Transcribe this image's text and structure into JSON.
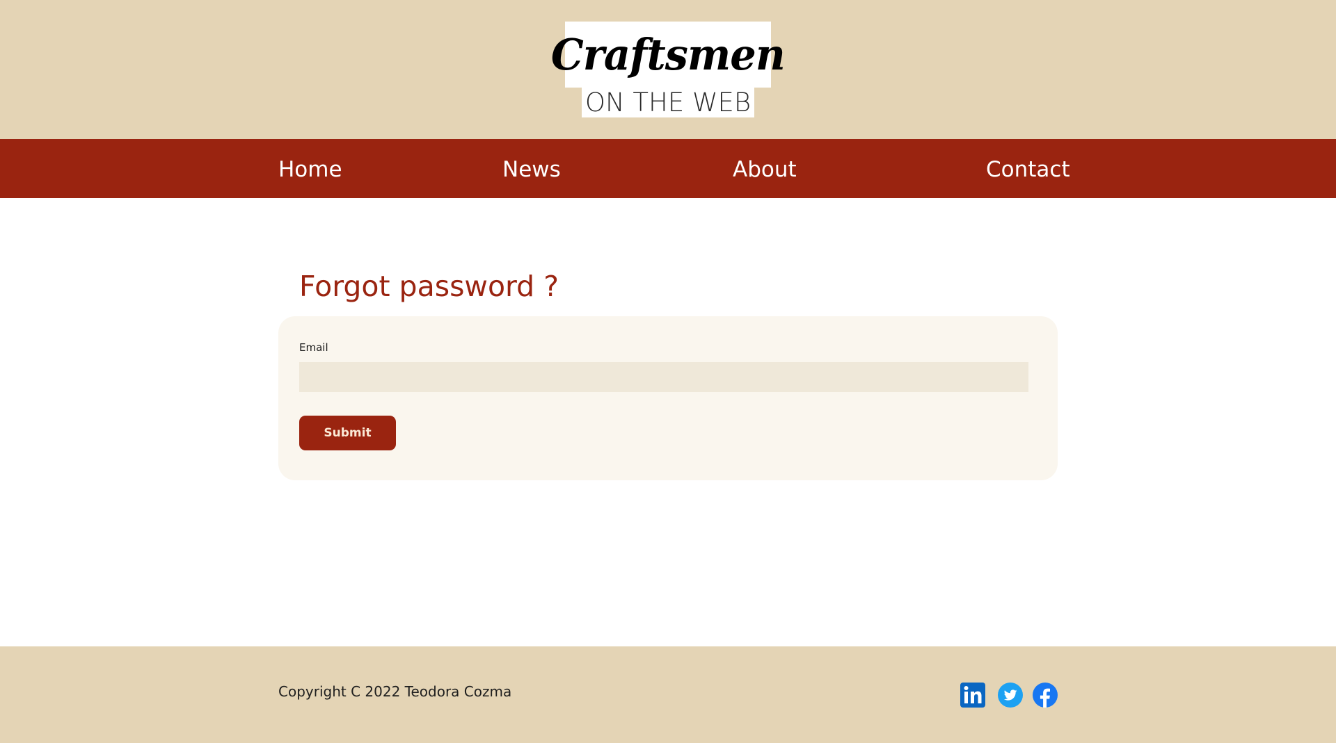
{
  "header": {
    "logo_line1": "Craftsmen",
    "logo_line2": "ON THE WEB"
  },
  "nav": {
    "items": [
      {
        "label": "Home"
      },
      {
        "label": "News"
      },
      {
        "label": "About"
      },
      {
        "label": "Contact"
      }
    ]
  },
  "main": {
    "title": "Forgot password ?",
    "form": {
      "email_label": "Email",
      "email_value": "",
      "submit_label": "Submit"
    }
  },
  "footer": {
    "copyright": "Copyright C 2022 Teodora Cozma",
    "social": [
      {
        "icon": "linkedin-icon",
        "color": "#0a66c2"
      },
      {
        "icon": "twitter-icon",
        "color": "#1da1f2"
      },
      {
        "icon": "facebook-icon",
        "color": "#1877f2"
      }
    ]
  },
  "colors": {
    "brand_red": "#9a2410",
    "header_bg": "#e4d4b5",
    "card_bg": "#faf6ee",
    "input_bg": "#efe8d9"
  }
}
